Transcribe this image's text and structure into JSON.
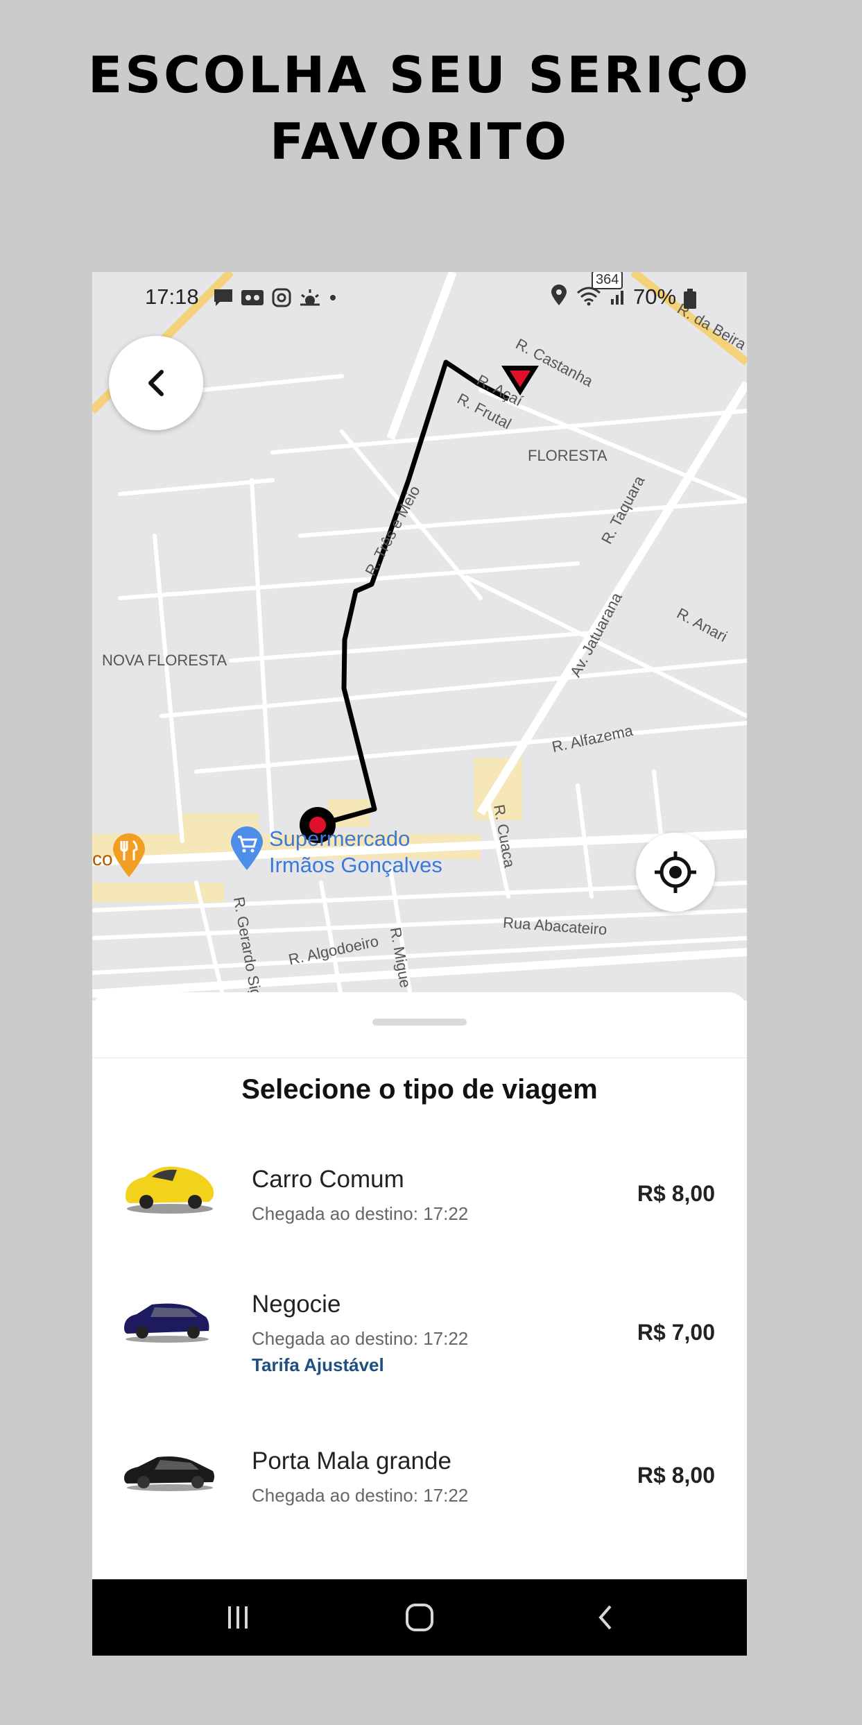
{
  "headline": {
    "line1": "ESCOLHA SEU SERIÇO",
    "line2": "FAVORITO"
  },
  "status_bar": {
    "time": "17:18",
    "network_badge": "364",
    "battery": "70%"
  },
  "map": {
    "labels": [
      "R. da Beira",
      "R. Castanha",
      "R. Açaí",
      "R. Frutal",
      "FLORESTA",
      "R. Taquara",
      "R. Três e Meio",
      "NOVA FLORESTA",
      "R. Anari",
      "Av. Jatuarana",
      "R. Alfazema",
      "R. Cuaca",
      "Rua Abacateiro",
      "R. Algodoeiro",
      "R. Gerardo Sig",
      "R. Migue",
      "co"
    ],
    "poi": {
      "line1": "Supermercado",
      "line2": "Irmãos Gonçalves"
    }
  },
  "sheet": {
    "title": "Selecione o tipo de viagem",
    "rides": [
      {
        "name": "Carro Comum",
        "eta": "Chegada ao destino: 17:22",
        "tag": "",
        "price": "R$ 8,00",
        "car_color": "#f2d21a"
      },
      {
        "name": "Negocie",
        "eta": "Chegada ao destino: 17:22",
        "tag": "Tarifa Ajustável",
        "price": "R$ 7,00",
        "car_color": "#1d1a5e"
      },
      {
        "name": "Porta Mala grande",
        "eta": "Chegada ao destino: 17:22",
        "tag": "",
        "price": "R$ 8,00",
        "car_color": "#1a1a1a"
      }
    ]
  },
  "colors": {
    "route": "#000000",
    "marker_red": "#e0102a",
    "map_bg": "#e6e6e9",
    "poi_blue": "#3b78d8",
    "commercial_yellow": "#f6e7b9"
  },
  "icons": [
    "back-arrow-icon",
    "locate-icon",
    "shopping-cart-icon",
    "restaurant-icon",
    "location-pin-icon",
    "wifi-icon",
    "signal-icon",
    "battery-icon",
    "recent-apps-icon",
    "home-icon",
    "nav-back-icon"
  ]
}
